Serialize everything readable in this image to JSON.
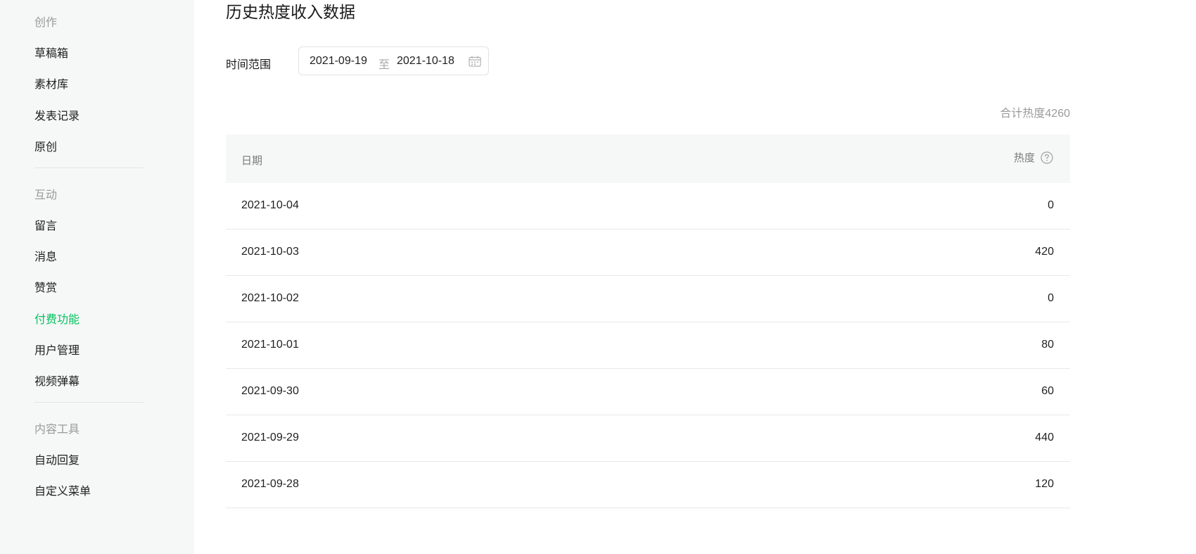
{
  "sidebar": {
    "groups": [
      {
        "title": "创作",
        "items": [
          "草稿箱",
          "素材库",
          "发表记录",
          "原创"
        ]
      },
      {
        "title": "互动",
        "items": [
          "留言",
          "消息",
          "赞赏",
          "付费功能",
          "用户管理",
          "视频弹幕"
        ]
      },
      {
        "title": "内容工具",
        "items": [
          "自动回复",
          "自定义菜单"
        ]
      }
    ],
    "active_item": "付费功能",
    "accent_color": "#07c160"
  },
  "main": {
    "title": "历史热度收入数据",
    "range_label": "时间范围",
    "range_start": "2021-09-19",
    "range_separator": "至",
    "range_end": "2021-10-18",
    "total": "合计热度4260",
    "table": {
      "headers": [
        "日期",
        "热度"
      ],
      "rows": [
        {
          "date": "2021-10-04",
          "heat": "0"
        },
        {
          "date": "2021-10-03",
          "heat": "420"
        },
        {
          "date": "2021-10-02",
          "heat": "0"
        },
        {
          "date": "2021-10-01",
          "heat": "80"
        },
        {
          "date": "2021-09-30",
          "heat": "60"
        },
        {
          "date": "2021-09-29",
          "heat": "440"
        },
        {
          "date": "2021-09-28",
          "heat": "120"
        }
      ]
    }
  }
}
